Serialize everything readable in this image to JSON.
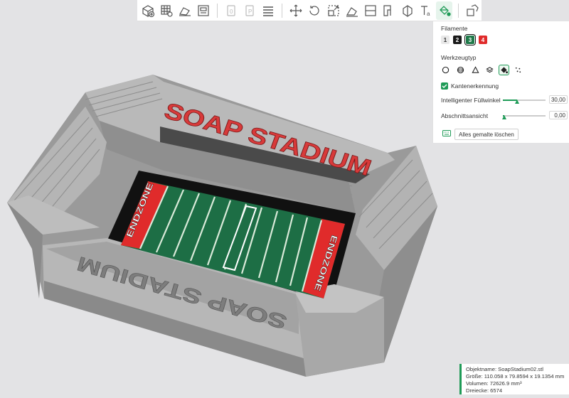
{
  "stadium": {
    "back_text": "SOAP STADIUM",
    "front_text": "SOAP STADIUM",
    "endzone_left": "ENDZONE",
    "endzone_right": "ENDZONE"
  },
  "toolbar": {
    "icons": [
      "add-object-icon",
      "grid-arrange-icon",
      "orient-icon",
      "plate-layout-icon",
      "object-list-icon",
      "parts-icon",
      "layers-icon",
      "move-icon",
      "rotate-icon",
      "scale-icon",
      "place-on-face-icon",
      "cut-icon",
      "support-paint-icon",
      "seam-paint-icon",
      "text-emboss-icon",
      "color-paint-icon",
      "assembly-icon"
    ]
  },
  "panel": {
    "filaments_title": "Filamente",
    "filaments": [
      {
        "label": "1",
        "color": "#e8e8e8",
        "text_color": "#333333"
      },
      {
        "label": "2",
        "color": "#1a1a1a",
        "text_color": "#ffffff"
      },
      {
        "label": "3",
        "color": "#1f7a4a",
        "text_color": "#ffffff",
        "selected": true
      },
      {
        "label": "4",
        "color": "#e02b2b",
        "text_color": "#ffffff"
      }
    ],
    "tooltype_title": "Werkzeugtyp",
    "tools": [
      "circle-icon",
      "sphere-icon",
      "triangle-icon",
      "layers-icon",
      "fill-bucket-icon",
      "gap-fill-icon"
    ],
    "edge_detection_label": "Kantenerkennung",
    "smart_fill_label": "Intelligenter Füllwinkel",
    "smart_fill_value": "30,00",
    "smart_fill_fraction": 0.33,
    "section_view_label": "Abschnittsansicht",
    "section_view_value": "0,00",
    "section_view_fraction": 0.0,
    "clear_button_label": "Alles gemalte löschen"
  },
  "info": {
    "line1": "Objektname: SoapStadium02.stl",
    "line2": "Größe: 110.058 x 79.8594 x 19.1354 mm",
    "line3": "Volumen: 72626.9 mm³",
    "line4": "Dreiecke: 6574"
  },
  "colors": {
    "accent": "#1f9b57",
    "field_green": "#1d6e45",
    "endzone_red": "#e02b2b",
    "stadium_grey": "#a9a9a9"
  }
}
